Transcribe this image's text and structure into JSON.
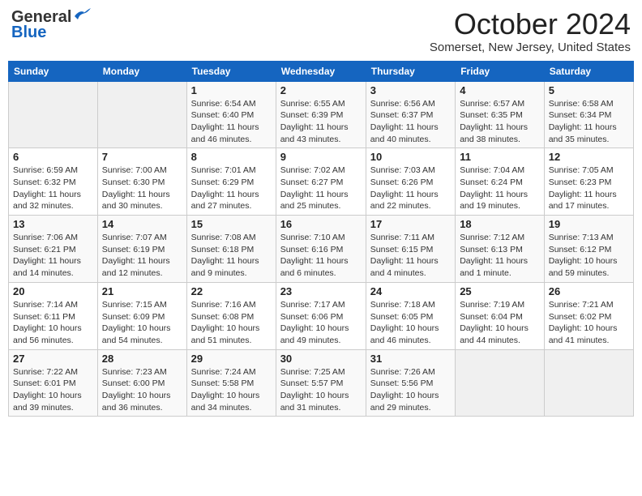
{
  "header": {
    "logo_line1": "General",
    "logo_line2": "Blue",
    "month": "October 2024",
    "location": "Somerset, New Jersey, United States"
  },
  "weekdays": [
    "Sunday",
    "Monday",
    "Tuesday",
    "Wednesday",
    "Thursday",
    "Friday",
    "Saturday"
  ],
  "weeks": [
    [
      {
        "day": "",
        "info": ""
      },
      {
        "day": "",
        "info": ""
      },
      {
        "day": "1",
        "info": "Sunrise: 6:54 AM\nSunset: 6:40 PM\nDaylight: 11 hours and 46 minutes."
      },
      {
        "day": "2",
        "info": "Sunrise: 6:55 AM\nSunset: 6:39 PM\nDaylight: 11 hours and 43 minutes."
      },
      {
        "day": "3",
        "info": "Sunrise: 6:56 AM\nSunset: 6:37 PM\nDaylight: 11 hours and 40 minutes."
      },
      {
        "day": "4",
        "info": "Sunrise: 6:57 AM\nSunset: 6:35 PM\nDaylight: 11 hours and 38 minutes."
      },
      {
        "day": "5",
        "info": "Sunrise: 6:58 AM\nSunset: 6:34 PM\nDaylight: 11 hours and 35 minutes."
      }
    ],
    [
      {
        "day": "6",
        "info": "Sunrise: 6:59 AM\nSunset: 6:32 PM\nDaylight: 11 hours and 32 minutes."
      },
      {
        "day": "7",
        "info": "Sunrise: 7:00 AM\nSunset: 6:30 PM\nDaylight: 11 hours and 30 minutes."
      },
      {
        "day": "8",
        "info": "Sunrise: 7:01 AM\nSunset: 6:29 PM\nDaylight: 11 hours and 27 minutes."
      },
      {
        "day": "9",
        "info": "Sunrise: 7:02 AM\nSunset: 6:27 PM\nDaylight: 11 hours and 25 minutes."
      },
      {
        "day": "10",
        "info": "Sunrise: 7:03 AM\nSunset: 6:26 PM\nDaylight: 11 hours and 22 minutes."
      },
      {
        "day": "11",
        "info": "Sunrise: 7:04 AM\nSunset: 6:24 PM\nDaylight: 11 hours and 19 minutes."
      },
      {
        "day": "12",
        "info": "Sunrise: 7:05 AM\nSunset: 6:23 PM\nDaylight: 11 hours and 17 minutes."
      }
    ],
    [
      {
        "day": "13",
        "info": "Sunrise: 7:06 AM\nSunset: 6:21 PM\nDaylight: 11 hours and 14 minutes."
      },
      {
        "day": "14",
        "info": "Sunrise: 7:07 AM\nSunset: 6:19 PM\nDaylight: 11 hours and 12 minutes."
      },
      {
        "day": "15",
        "info": "Sunrise: 7:08 AM\nSunset: 6:18 PM\nDaylight: 11 hours and 9 minutes."
      },
      {
        "day": "16",
        "info": "Sunrise: 7:10 AM\nSunset: 6:16 PM\nDaylight: 11 hours and 6 minutes."
      },
      {
        "day": "17",
        "info": "Sunrise: 7:11 AM\nSunset: 6:15 PM\nDaylight: 11 hours and 4 minutes."
      },
      {
        "day": "18",
        "info": "Sunrise: 7:12 AM\nSunset: 6:13 PM\nDaylight: 11 hours and 1 minute."
      },
      {
        "day": "19",
        "info": "Sunrise: 7:13 AM\nSunset: 6:12 PM\nDaylight: 10 hours and 59 minutes."
      }
    ],
    [
      {
        "day": "20",
        "info": "Sunrise: 7:14 AM\nSunset: 6:11 PM\nDaylight: 10 hours and 56 minutes."
      },
      {
        "day": "21",
        "info": "Sunrise: 7:15 AM\nSunset: 6:09 PM\nDaylight: 10 hours and 54 minutes."
      },
      {
        "day": "22",
        "info": "Sunrise: 7:16 AM\nSunset: 6:08 PM\nDaylight: 10 hours and 51 minutes."
      },
      {
        "day": "23",
        "info": "Sunrise: 7:17 AM\nSunset: 6:06 PM\nDaylight: 10 hours and 49 minutes."
      },
      {
        "day": "24",
        "info": "Sunrise: 7:18 AM\nSunset: 6:05 PM\nDaylight: 10 hours and 46 minutes."
      },
      {
        "day": "25",
        "info": "Sunrise: 7:19 AM\nSunset: 6:04 PM\nDaylight: 10 hours and 44 minutes."
      },
      {
        "day": "26",
        "info": "Sunrise: 7:21 AM\nSunset: 6:02 PM\nDaylight: 10 hours and 41 minutes."
      }
    ],
    [
      {
        "day": "27",
        "info": "Sunrise: 7:22 AM\nSunset: 6:01 PM\nDaylight: 10 hours and 39 minutes."
      },
      {
        "day": "28",
        "info": "Sunrise: 7:23 AM\nSunset: 6:00 PM\nDaylight: 10 hours and 36 minutes."
      },
      {
        "day": "29",
        "info": "Sunrise: 7:24 AM\nSunset: 5:58 PM\nDaylight: 10 hours and 34 minutes."
      },
      {
        "day": "30",
        "info": "Sunrise: 7:25 AM\nSunset: 5:57 PM\nDaylight: 10 hours and 31 minutes."
      },
      {
        "day": "31",
        "info": "Sunrise: 7:26 AM\nSunset: 5:56 PM\nDaylight: 10 hours and 29 minutes."
      },
      {
        "day": "",
        "info": ""
      },
      {
        "day": "",
        "info": ""
      }
    ]
  ]
}
